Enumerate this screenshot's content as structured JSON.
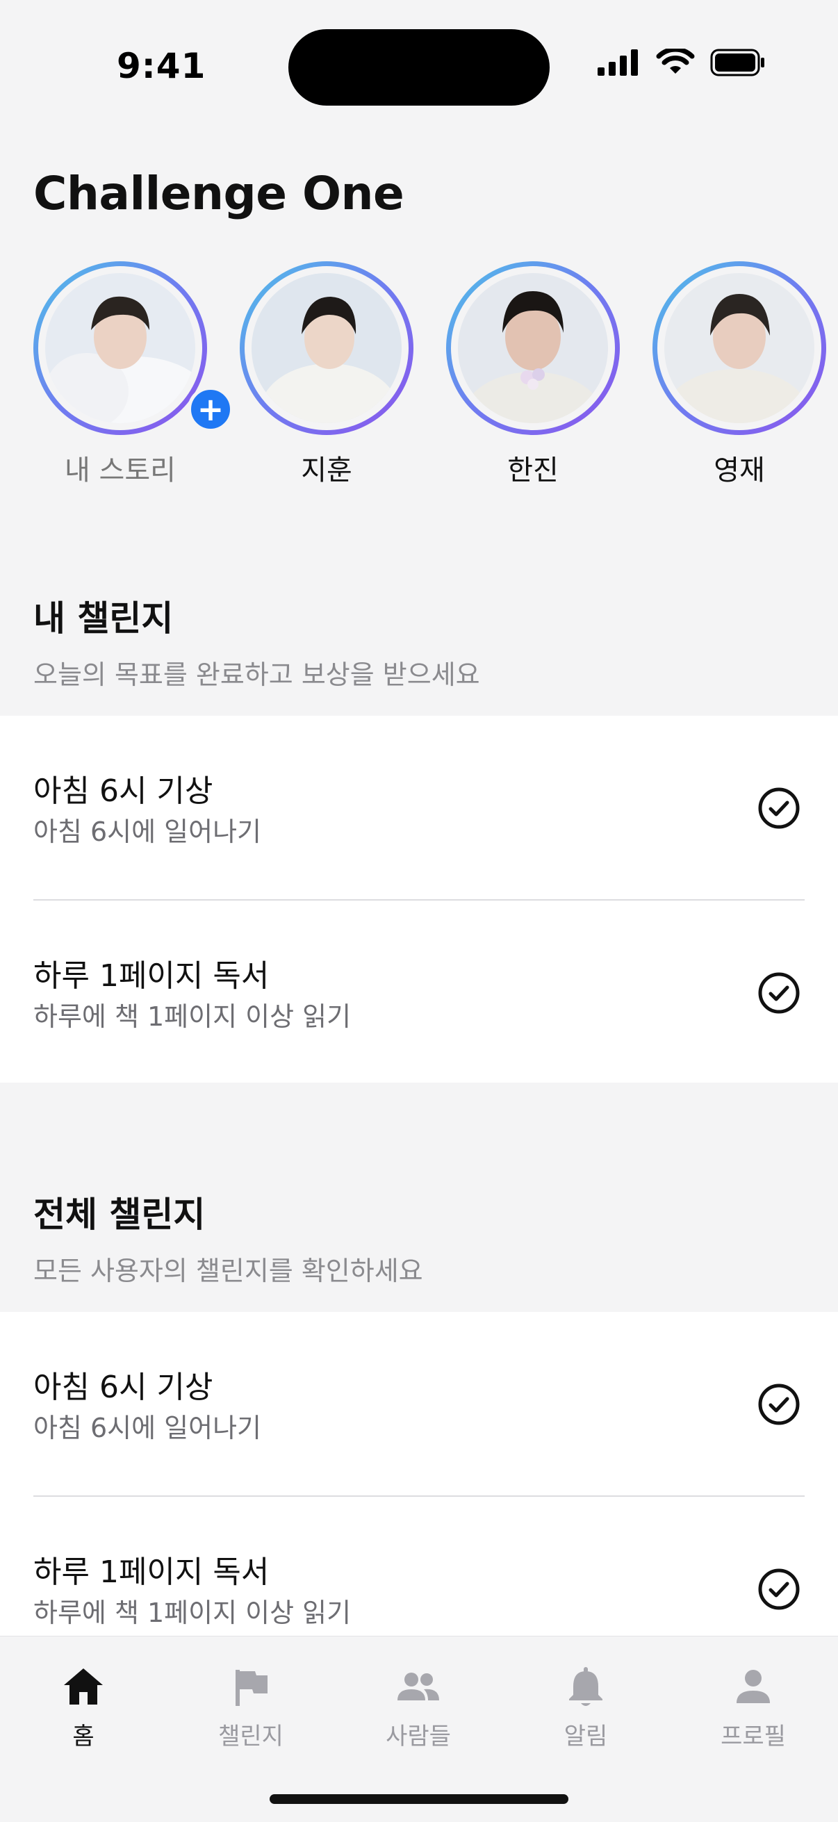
{
  "status_bar": {
    "time": "9:41"
  },
  "app_title": "Challenge One",
  "stories": [
    {
      "name": "내 스토리",
      "is_self": true
    },
    {
      "name": "지훈",
      "is_self": false
    },
    {
      "name": "한진",
      "is_self": false
    },
    {
      "name": "영재",
      "is_self": false
    }
  ],
  "add_story_symbol": "+",
  "my_challenges": {
    "title": "내 챌린지",
    "subtitle": "오늘의 목표를 완료하고 보상을 받으세요",
    "items": [
      {
        "title": "아침 6시 기상",
        "description": "아침 6시에 일어나기",
        "icon": "check-circle-icon"
      },
      {
        "title": "하루 1페이지 독서",
        "description": "하루에 책 1페이지 이상 읽기",
        "icon": "check-circle-icon"
      }
    ]
  },
  "all_challenges": {
    "title": "전체 챌린지",
    "subtitle": "모든 사용자의 챌린지를 확인하세요",
    "items": [
      {
        "title": "아침 6시 기상",
        "description": "아침 6시에 일어나기",
        "icon": "check-circle-icon"
      },
      {
        "title": "하루 1페이지 독서",
        "description": "하루에 책 1페이지 이상 읽기",
        "icon": "check-circle-icon"
      }
    ]
  },
  "tabbar": {
    "active": "홈",
    "tabs": [
      {
        "label": "홈",
        "icon": "home-icon"
      },
      {
        "label": "챌린지",
        "icon": "flag-icon"
      },
      {
        "label": "사람들",
        "icon": "people-icon"
      },
      {
        "label": "알림",
        "icon": "bell-icon"
      },
      {
        "label": "프로필",
        "icon": "person-icon"
      }
    ]
  },
  "colors": {
    "accent": "#1f78f4",
    "ring_start": "#4fc2e8",
    "ring_end": "#8b55ec",
    "background": "#f4f4f5",
    "card": "#ffffff"
  }
}
